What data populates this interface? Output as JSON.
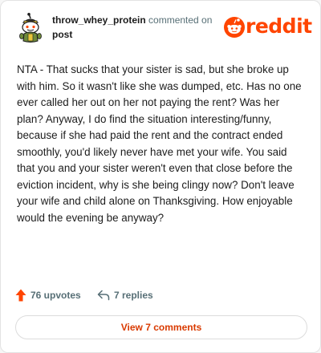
{
  "comment": {
    "username": "throw_whey_protein",
    "commented_text": "commented on",
    "post_link": "post",
    "body": "NTA - That sucks that your sister is sad, but she broke up with him. So it wasn't like she was dumped, etc. Has no one ever called her out on her not paying the rent? Was her plan? Anyway, I do find the situation interesting/funny, because if she had paid the rent and the contract ended smoothly, you'd likely never have met your wife. You said that you and your sister weren't even that close before the eviction incident, why is she being clingy now? Don't leave your wife and child alone on Thanksgiving. How enjoyable would the evening be anyway?"
  },
  "brand": {
    "name": "reddit",
    "color": "#ff4500",
    "icon": "reddit-snoo-icon"
  },
  "actions": {
    "upvotes": "76 upvotes",
    "upvote_icon": "upvote-arrow-icon",
    "upvote_color": "#ff4500",
    "replies": "7 replies",
    "reply_icon": "reply-arrow-icon"
  },
  "view_button": {
    "label": "View 7 comments",
    "color": "#d93a00"
  }
}
